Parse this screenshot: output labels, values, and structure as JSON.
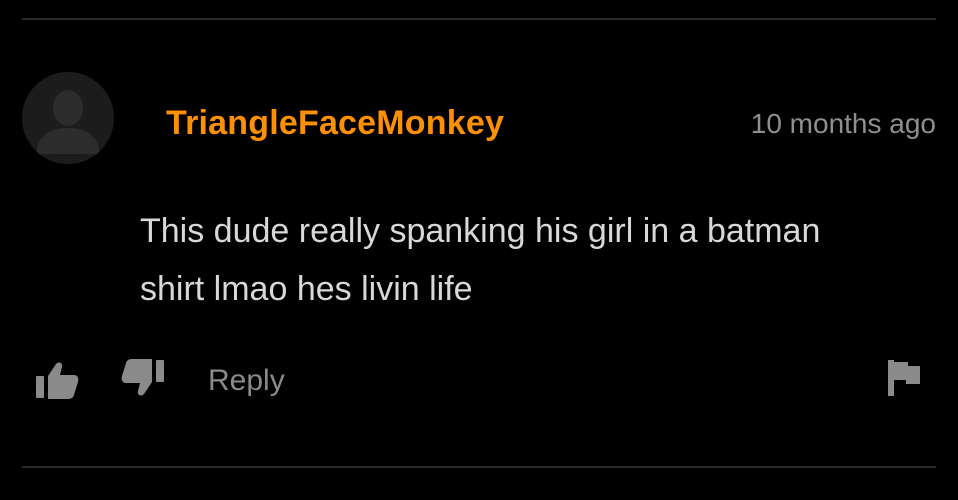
{
  "comment": {
    "username": "TriangleFaceMonkey",
    "timestamp": "10 months ago",
    "text": "This dude really spanking his girl in a batman shirt lmao hes livin life"
  },
  "actions": {
    "reply_label": "Reply"
  },
  "icons": {
    "avatar": "user-silhouette-icon",
    "thumbs_up": "thumbs-up-icon",
    "thumbs_down": "thumbs-down-icon",
    "flag": "flag-icon"
  },
  "colors": {
    "background": "#000000",
    "username": "#ff9000",
    "text": "#d8d8d8",
    "muted": "#8a8a8a",
    "divider": "#2a2a2a"
  }
}
